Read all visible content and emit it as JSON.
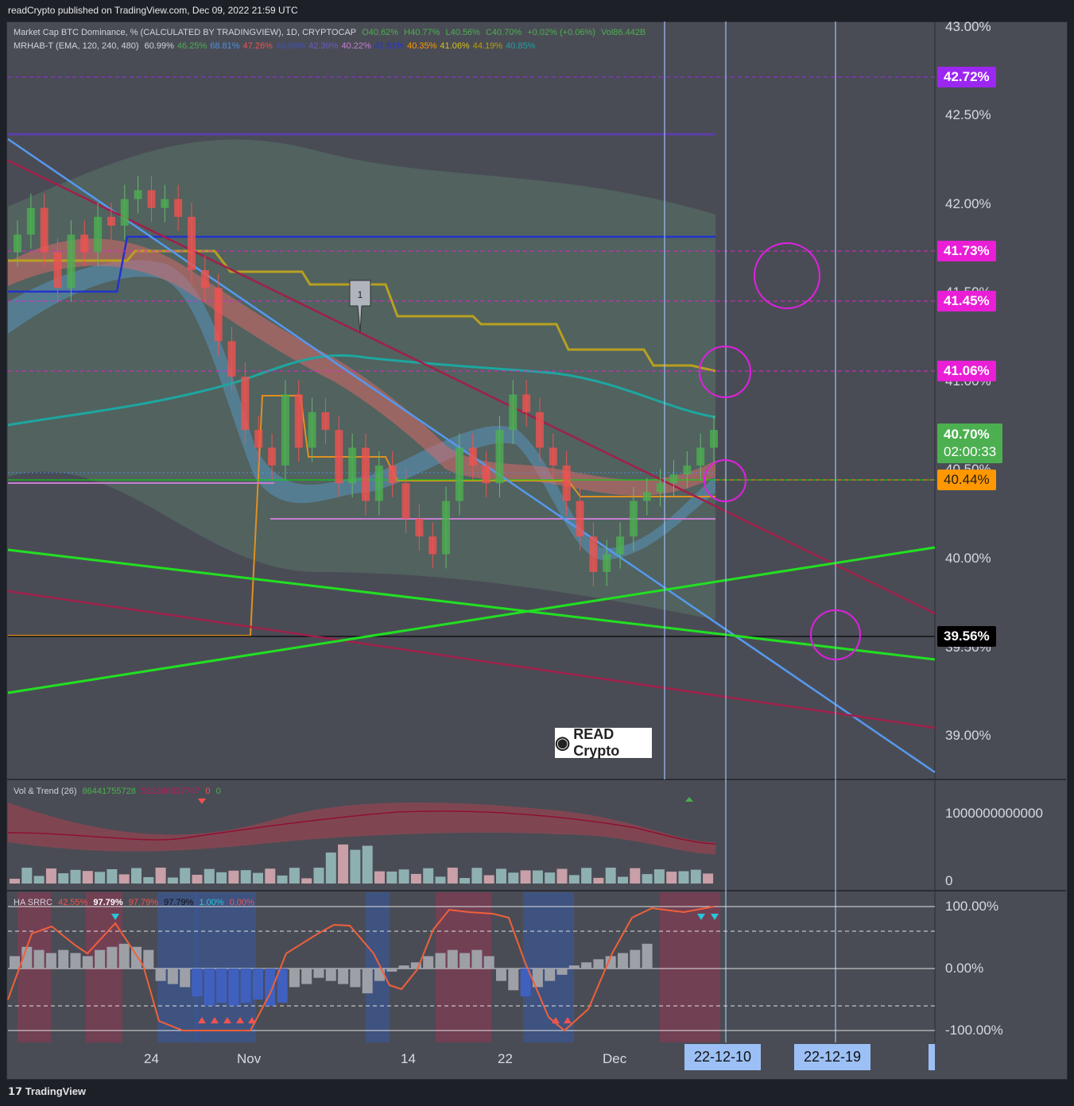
{
  "header": {
    "published": "readCrypto published on TradingView.com, Dec 09, 2022 21:59 UTC"
  },
  "legend_main": {
    "title": "Market Cap BTC Dominance, % (CALCULATED BY TRADINGVIEW), 1D, CRYPTOCAP",
    "open": "O40.62%",
    "high": "H40.77%",
    "low": "L40.56%",
    "close": "C40.70%",
    "change": "+0.02% (+0.06%)",
    "vol": "Vol86.442B"
  },
  "legend_ind": {
    "name": "MRHAB-T (EMA, 120, 240, 480)",
    "values": [
      {
        "text": "60.99%",
        "color": "#d1d4dc"
      },
      {
        "text": "46.25%",
        "color": "#4caf50"
      },
      {
        "text": "68.81%",
        "color": "#4d8fe0"
      },
      {
        "text": "47.26%",
        "color": "#f05350"
      },
      {
        "text": "46.89%",
        "color": "#3f51b5"
      },
      {
        "text": "42.39%",
        "color": "#6a5acd"
      },
      {
        "text": "40.22%",
        "color": "#c77dd0"
      },
      {
        "text": "41.81%",
        "color": "#2233dd"
      },
      {
        "text": "40.35%",
        "color": "#ff9800"
      },
      {
        "text": "41.06%",
        "color": "#d4c21a"
      },
      {
        "text": "44.19%",
        "color": "#b8a000"
      },
      {
        "text": "40.85%",
        "color": "#20a0a0"
      }
    ]
  },
  "price_axis": [
    "43.00%",
    "42.50%",
    "42.00%",
    "40.00%",
    "39.00%"
  ],
  "partial_axis": [
    "41.50%",
    "41.00%",
    "40.50%",
    "39.50%"
  ],
  "tags": [
    {
      "text": "42.72%",
      "bg": "#9c27f0",
      "fg": "#ffffff"
    },
    {
      "text": "41.73%",
      "bg": "#e91ed6",
      "fg": "#ffffff"
    },
    {
      "text": "41.45%",
      "bg": "#e91ed6",
      "fg": "#ffffff"
    },
    {
      "text": "41.06%",
      "bg": "#e91ed6",
      "fg": "#ffffff"
    },
    {
      "text": "40.44%",
      "bg": "#ff9800",
      "fg": "#1e1e1e"
    },
    {
      "text": "39.56%",
      "bg": "#000000",
      "fg": "#ffffff"
    }
  ],
  "current": {
    "price": "40.70%",
    "countdown": "02:00:33",
    "bg": "#4caf50"
  },
  "pin_label": "1",
  "logo_text": "READ Crypto",
  "vol_legend": {
    "name": "Vol & Trend (26)",
    "v1": "86441755728",
    "v2": "531366337747",
    "v3": "0",
    "v4": "0"
  },
  "vol_axis": [
    "1000000000000",
    "0"
  ],
  "osc_legend": {
    "name": "HA SRRC",
    "v1": "42.55%",
    "v2": "97.79%",
    "v3": "97.79%",
    "v4": "97.79%",
    "v5": "1.00%",
    "v6": "0.00%"
  },
  "osc_axis": [
    "100.00%",
    "0.00%",
    "-100.00%"
  ],
  "x_axis": [
    "24",
    "Nov",
    "14",
    "22",
    "Dec"
  ],
  "date_boxes": [
    "22-12-10",
    "22-12-19"
  ],
  "footer": "TradingView",
  "chart_data": {
    "type": "candlestick",
    "title": "Market Cap BTC Dominance, % (CALCULATED BY TRADINGVIEW), 1D, CRYPTOCAP",
    "ylim": [
      38.75,
      43.0
    ],
    "y_ticks": [
      39.0,
      40.0,
      42.0,
      42.5,
      43.0
    ],
    "x_ticks": [
      "24",
      "Nov",
      "14",
      "22",
      "Dec"
    ],
    "candles_close": [
      41.8,
      41.95,
      41.7,
      41.5,
      41.8,
      41.7,
      41.9,
      41.85,
      42.0,
      42.05,
      41.95,
      42.0,
      41.9,
      41.6,
      41.5,
      41.2,
      41.0,
      40.7,
      40.6,
      40.5,
      40.9,
      40.6,
      40.8,
      40.7,
      40.4,
      40.6,
      40.3,
      40.5,
      40.4,
      40.2,
      40.1,
      40.0,
      40.3,
      40.6,
      40.5,
      40.4,
      40.7,
      40.9,
      40.8,
      40.6,
      40.5,
      40.3,
      40.1,
      39.9,
      40.0,
      40.1,
      40.3,
      40.35,
      40.4,
      40.45,
      40.5,
      40.6,
      40.7
    ],
    "levels": [
      42.72,
      41.73,
      41.45,
      41.06,
      40.44,
      39.56
    ],
    "current_price": 40.7
  }
}
